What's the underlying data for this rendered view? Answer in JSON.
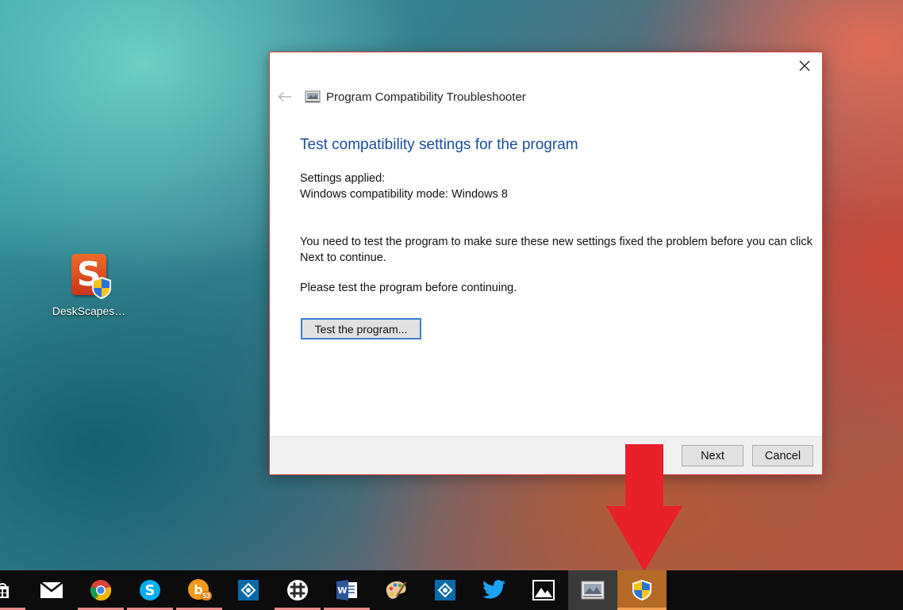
{
  "desktop": {
    "icons": [
      {
        "label": "DeskScapes…",
        "icon": "deskscapes-icon"
      }
    ]
  },
  "dialog": {
    "title": "Program Compatibility Troubleshooter",
    "heading": "Test compatibility settings for the program",
    "settings_label": "Settings applied:",
    "settings_value": "Windows compatibility mode: Windows 8",
    "body": "You need to test the program to make sure these new settings fixed the problem before you can click Next to continue.",
    "please_test": "Please test the program before continuing.",
    "test_button": "Test the program...",
    "next_button": "Next",
    "cancel_button": "Cancel",
    "close_icon": "close-icon",
    "back_icon": "back-arrow-icon"
  },
  "taskbar": {
    "items": [
      {
        "name": "store",
        "icon": "store-icon"
      },
      {
        "name": "mail",
        "icon": "mail-icon"
      },
      {
        "name": "chrome",
        "icon": "chrome-icon"
      },
      {
        "name": "skype",
        "icon": "skype-icon"
      },
      {
        "name": "badge-app",
        "icon": "notification-app-icon",
        "badge": "53"
      },
      {
        "name": "remote-desktop",
        "icon": "remote-desktop-icon"
      },
      {
        "name": "slack",
        "icon": "slack-icon"
      },
      {
        "name": "word",
        "icon": "word-icon"
      },
      {
        "name": "paint",
        "icon": "paint-icon"
      },
      {
        "name": "remote-desktop-2",
        "icon": "remote-desktop-icon"
      },
      {
        "name": "twitter",
        "icon": "twitter-icon"
      },
      {
        "name": "photos",
        "icon": "photos-icon"
      },
      {
        "name": "troubleshooter",
        "icon": "troubleshooter-icon"
      },
      {
        "name": "uac-shield",
        "icon": "shield-icon"
      }
    ]
  },
  "colors": {
    "heading": "#1a4d9a",
    "dialog_border": "#d23a3a",
    "arrow": "#e8202a",
    "taskbar": "#0c0c0c",
    "focused_taskbar_item": "#b46a26"
  }
}
